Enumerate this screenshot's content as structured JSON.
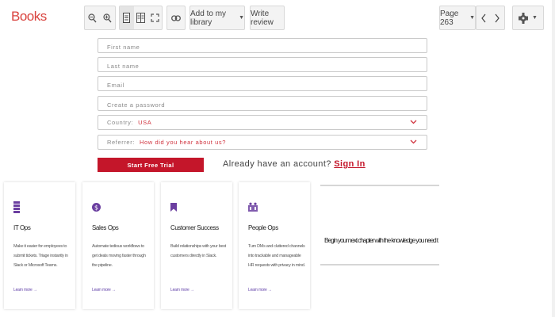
{
  "toolbar": {
    "brand": "Books",
    "add_library_label": "Add to my library",
    "write_review_label": "Write review",
    "page_label": "Page 263"
  },
  "form": {
    "first_name_placeholder": "First name",
    "last_name_placeholder": "Last name",
    "email_placeholder": "Email",
    "password_placeholder": "Create a password",
    "country_label": "Country:",
    "country_value": "USA",
    "referrer_label": "Referrer:",
    "referrer_value": "How did you hear about us?",
    "trial_button": "Start Free Trial",
    "account_prompt": "Already have an account?",
    "signin_link": "Sign In"
  },
  "cards": [
    {
      "title": "IT Ops",
      "desc": "Make it easier for employees to submit tickets. Triage instantly in Slack or Microsoft Teams.",
      "link": "Learn more →",
      "icon": "stack-icon"
    },
    {
      "title": "Sales Ops",
      "desc": "Automate tedious workflows to get deals moving faster through the pipeline.",
      "link": "Learn more →",
      "icon": "dollar-icon"
    },
    {
      "title": "Customer Success",
      "desc": "Build relationships with your best customers directly in Slack.",
      "link": "Learn more →",
      "icon": "bookmark-icon"
    },
    {
      "title": "People Ops",
      "desc": "Turn DMs and cluttered channels into trackable and manageable HR requests with privacy in mind.",
      "link": "Learn more →",
      "icon": "people-icon"
    }
  ],
  "banner": {
    "text": "Begin your next chapter with the knowledge you need to grow."
  },
  "colors": {
    "brand": "#d9433e",
    "accent": "#c4162a",
    "card_icon": "#6b3fa0"
  }
}
